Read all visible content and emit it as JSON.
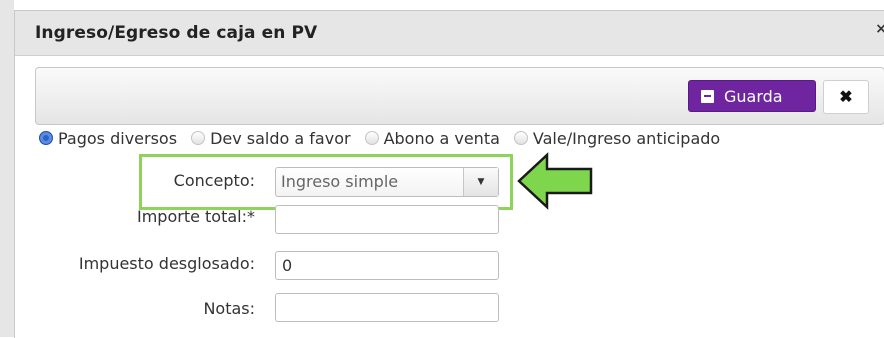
{
  "dialog": {
    "title": "Ingreso/Egreso de caja en PV",
    "title_close": "×"
  },
  "toolbar": {
    "save_label": "Guarda",
    "close_label": "✖"
  },
  "radios": [
    {
      "label": "Pagos diversos",
      "checked": true
    },
    {
      "label": "Dev saldo a favor",
      "checked": false
    },
    {
      "label": "Abono a venta",
      "checked": false
    },
    {
      "label": "Vale/Ingreso anticipado",
      "checked": false
    }
  ],
  "form": {
    "concepto_label": "Concepto:",
    "concepto_value": "Ingreso simple",
    "importe_label": "Importe total:*",
    "importe_value": "",
    "impuesto_label": "Impuesto desglosado:",
    "impuesto_value": "0",
    "notas_label": "Notas:",
    "notas_value": ""
  },
  "annotation": {
    "highlight_color": "#8fd45a",
    "arrow_color": "#7ed64d"
  },
  "colors": {
    "primary_button": "#6f25a0",
    "radio_checked": "#2d62c8"
  },
  "icons": {
    "save": "save-icon",
    "close": "close-icon",
    "dropdown": "chevron-down-icon",
    "pointer": "arrow-left-icon"
  }
}
